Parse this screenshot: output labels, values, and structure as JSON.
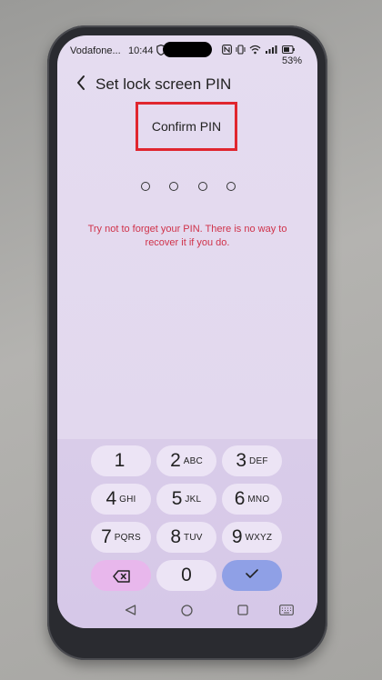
{
  "status_bar": {
    "carrier": "Vodafone...",
    "time": "10:44",
    "battery": "53%"
  },
  "header": {
    "title": "Set lock screen PIN"
  },
  "prompt": "Confirm PIN",
  "pin_length": 4,
  "warning": "Try not to forget your PIN. There is no way to recover it if you do.",
  "keypad": {
    "keys": [
      {
        "num": "1",
        "letters": ""
      },
      {
        "num": "2",
        "letters": "ABC"
      },
      {
        "num": "3",
        "letters": "DEF"
      },
      {
        "num": "4",
        "letters": "GHI"
      },
      {
        "num": "5",
        "letters": "JKL"
      },
      {
        "num": "6",
        "letters": "MNO"
      },
      {
        "num": "7",
        "letters": "PQRS"
      },
      {
        "num": "8",
        "letters": "TUV"
      },
      {
        "num": "9",
        "letters": "WXYZ"
      },
      {
        "num": "0",
        "letters": ""
      }
    ],
    "delete_icon": "backspace-icon",
    "confirm_icon": "checkmark-icon"
  },
  "colors": {
    "highlight_box": "#e0262f",
    "warning_text": "#d0324a",
    "delete_key": "#e8b7ec",
    "confirm_key": "#8fa0e6"
  }
}
